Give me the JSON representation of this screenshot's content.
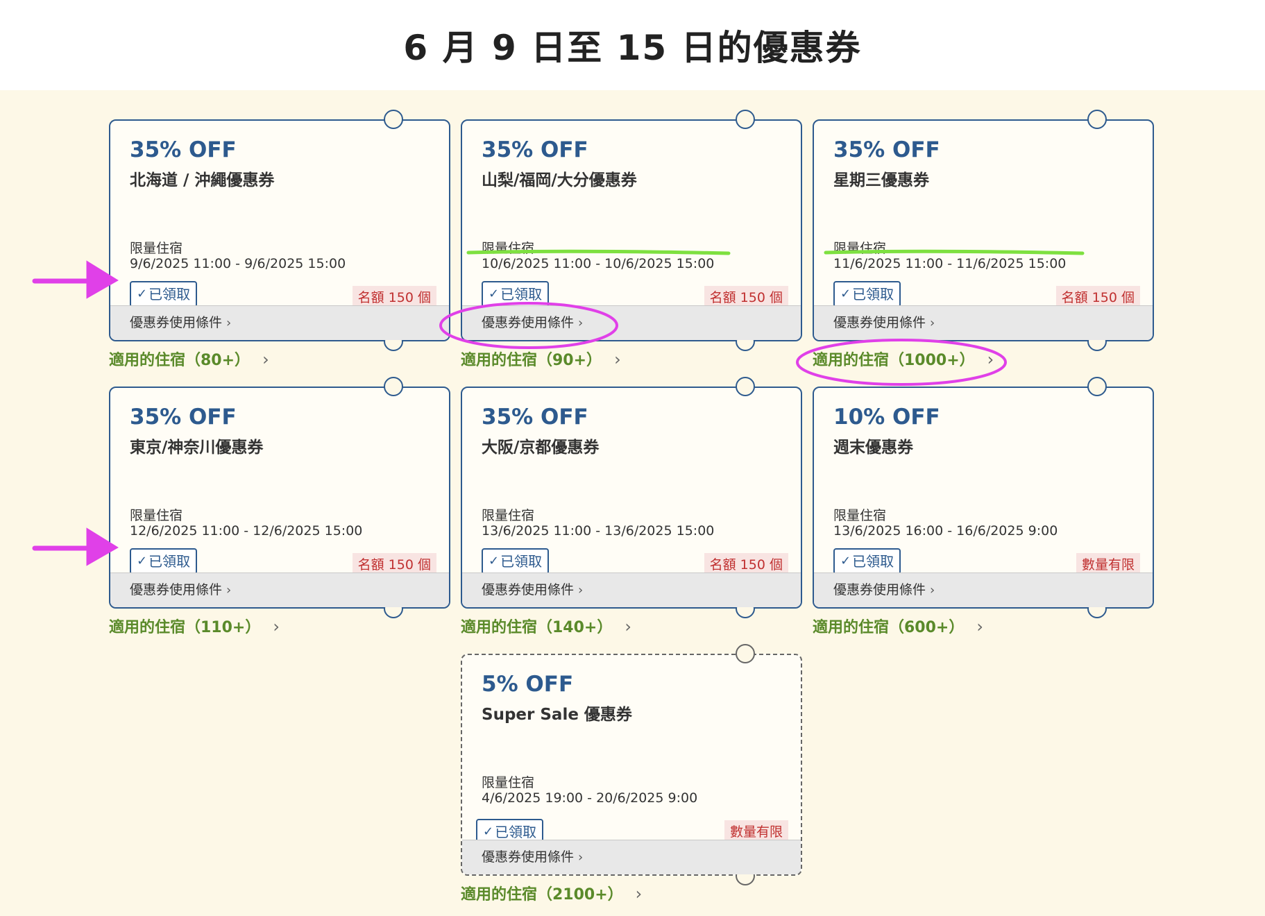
{
  "page_title": "6 月 9 日至 15 日的優惠券",
  "coupon_labels": {
    "terms": "優惠券使用條件",
    "claimed": "已領取"
  },
  "coupons": [
    {
      "discount": "35% OFF",
      "title": "北海道 / 沖繩優惠券",
      "type": "限量住宿",
      "period": "9/6/2025 11:00 - 9/6/2025 15:00",
      "quota": "名額 150 個",
      "applicable": "適用的住宿（80+）"
    },
    {
      "discount": "35% OFF",
      "title": "山梨/福岡/大分優惠券",
      "type": "限量住宿",
      "period": "10/6/2025 11:00 - 10/6/2025 15:00",
      "quota": "名額 150 個",
      "applicable": "適用的住宿（90+）"
    },
    {
      "discount": "35% OFF",
      "title": "星期三優惠券",
      "type": "限量住宿",
      "period": "11/6/2025 11:00 - 11/6/2025 15:00",
      "quota": "名額 150 個",
      "applicable": "適用的住宿（1000+）"
    },
    {
      "discount": "35% OFF",
      "title": "東京/神奈川優惠券",
      "type": "限量住宿",
      "period": "12/6/2025 11:00 - 12/6/2025 15:00",
      "quota": "名額 150 個",
      "applicable": "適用的住宿（110+）"
    },
    {
      "discount": "35% OFF",
      "title": "大阪/京都優惠券",
      "type": "限量住宿",
      "period": "13/6/2025 11:00 - 13/6/2025 15:00",
      "quota": "名額 150 個",
      "applicable": "適用的住宿（140+）"
    },
    {
      "discount": "10% OFF",
      "title": "週末優惠券",
      "type": "限量住宿",
      "period": "13/6/2025 16:00 - 16/6/2025 9:00",
      "quota": "數量有限",
      "applicable": "適用的住宿（600+）"
    },
    {
      "discount": "5% OFF",
      "title": "Super Sale 優惠券",
      "type": "限量住宿",
      "period": "4/6/2025 19:00 - 20/6/2025 9:00",
      "quota": "數量有限",
      "applicable": "適用的住宿（2100+）"
    }
  ],
  "colors": {
    "background": "#fdf8e7",
    "coupon_border": "#2d5a8e",
    "discount_text": "#2d5a8e",
    "quota_text": "#c03030",
    "applicable_text": "#5a8a2a",
    "annotation_magenta": "#e040e8",
    "annotation_green": "#7ee040"
  }
}
